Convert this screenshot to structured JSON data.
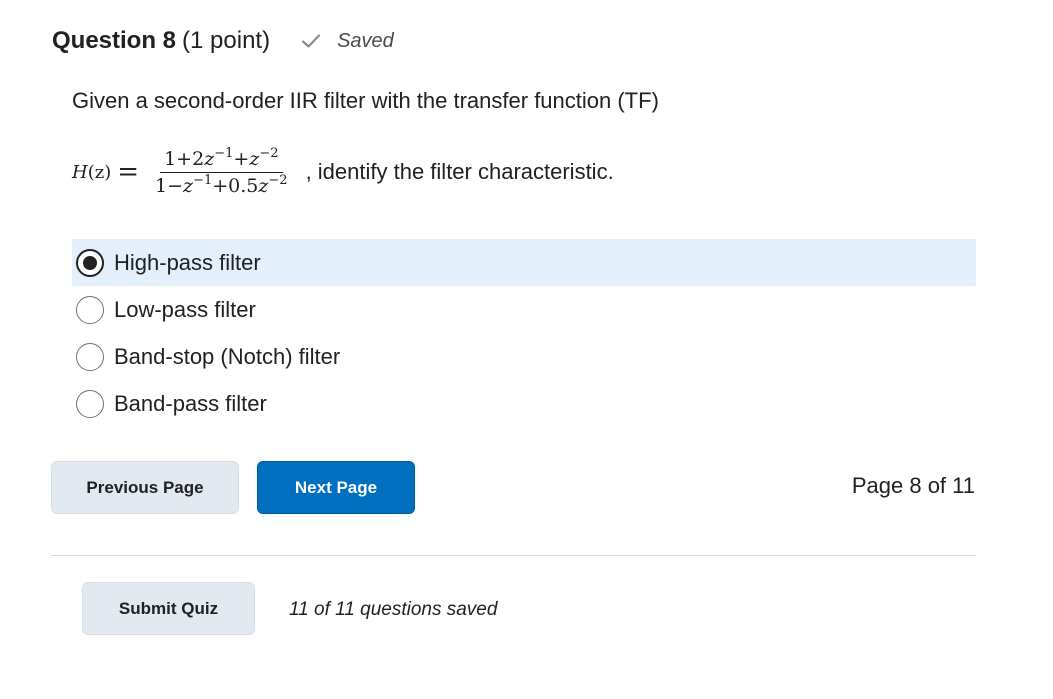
{
  "question": {
    "title": "Question 8",
    "points": "(1 point)",
    "saved_label": "Saved",
    "text": "Given a second-order IIR filter with the transfer function (TF)",
    "formula": {
      "lhs_func": "H",
      "lhs_var": "(z)",
      "equals": "=",
      "num_1": "1+2",
      "num_z1": "z",
      "num_exp1": "−1",
      "num_plus": "+",
      "num_z2": "z",
      "num_exp2": "−2",
      "den_1": "1−",
      "den_z1": "z",
      "den_exp1": "−1",
      "den_plus": "+0.5",
      "den_z2": "z",
      "den_exp2": "−2"
    },
    "after_formula": ", identify the filter characteristic.",
    "options": [
      {
        "label": "High-pass filter",
        "selected": true
      },
      {
        "label": "Low-pass filter",
        "selected": false
      },
      {
        "label": "Band-stop (Notch) filter",
        "selected": false
      },
      {
        "label": "Band-pass filter",
        "selected": false
      }
    ]
  },
  "nav": {
    "previous_label": "Previous Page",
    "next_label": "Next Page",
    "page_indicator": "Page 8 of 11"
  },
  "footer": {
    "submit_label": "Submit Quiz",
    "saved_status": "11 of 11 questions saved"
  },
  "colors": {
    "accent": "#006fbf",
    "selected_bg": "#e3effb",
    "secondary_button_bg": "#e3e9f1",
    "check": "#8a8d90"
  },
  "icons": {
    "saved": "checkmark-icon"
  }
}
